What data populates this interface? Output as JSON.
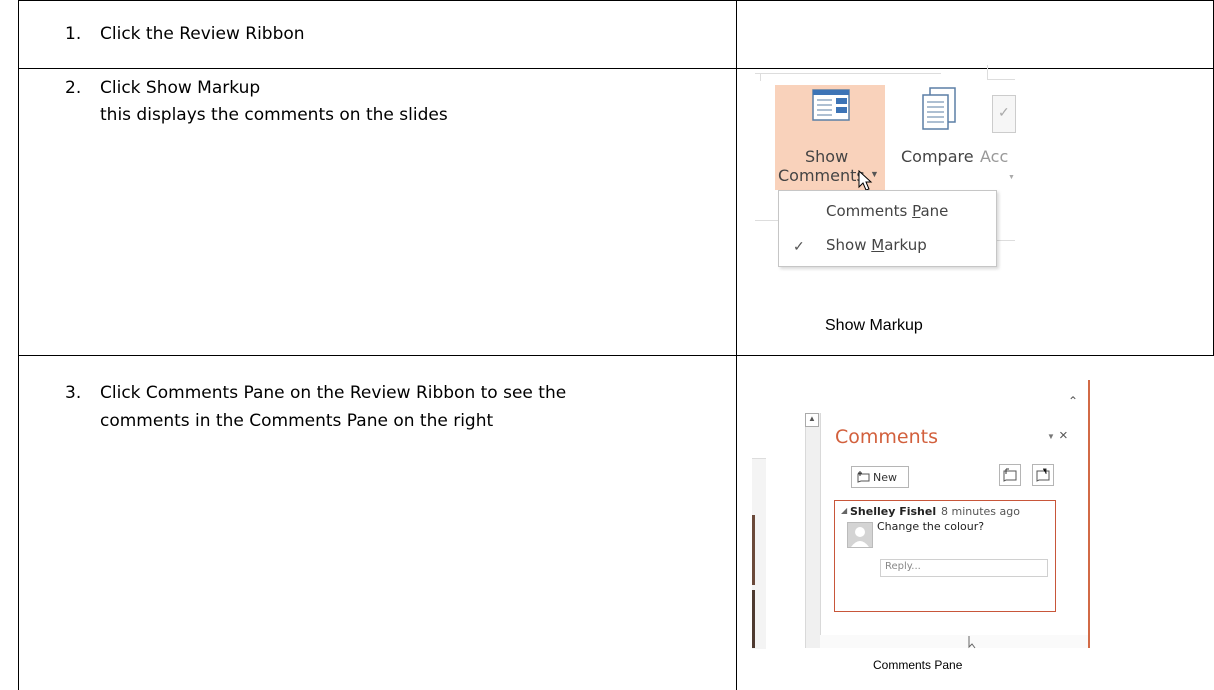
{
  "steps": [
    {
      "number": "1.",
      "lines": [
        "Click the Review Ribbon"
      ]
    },
    {
      "number": "2.",
      "lines": [
        "Click Show Markup",
        "this displays the comments on the slides"
      ]
    },
    {
      "number": "3.",
      "lines": [
        "Click Comments Pane on the Review Ribbon to see the",
        "comments in the Comments Pane on the right"
      ]
    }
  ],
  "figure_show_markup": {
    "button_line1": "Show",
    "button_line2": "Comments",
    "compare_label": "Compare",
    "acc_label": "Acc",
    "menu": {
      "item1_pre": "Comments ",
      "item1_ul": "P",
      "item1_post": "ane",
      "item2_pre": "Show ",
      "item2_ul": "M",
      "item2_post": "arkup",
      "checkmark": "✓"
    },
    "caption": "Show Markup"
  },
  "figure_comments_pane": {
    "title": "Comments",
    "new_button": "New",
    "author": "Shelley Fishel",
    "time": "8 minutes ago",
    "comment_text": "Change the colour?",
    "reply_placeholder": "Reply...",
    "caption": "Comments Pane"
  },
  "icons": [
    "show-comments-icon",
    "compare-icon",
    "accept-icon",
    "dropdown-arrow-icon",
    "mouse-cursor-icon",
    "checkmark-icon",
    "close-icon",
    "new-comment-icon",
    "previous-comment-icon",
    "next-comment-icon",
    "avatar-icon",
    "collapse-triangle-icon",
    "scroll-up-icon"
  ]
}
